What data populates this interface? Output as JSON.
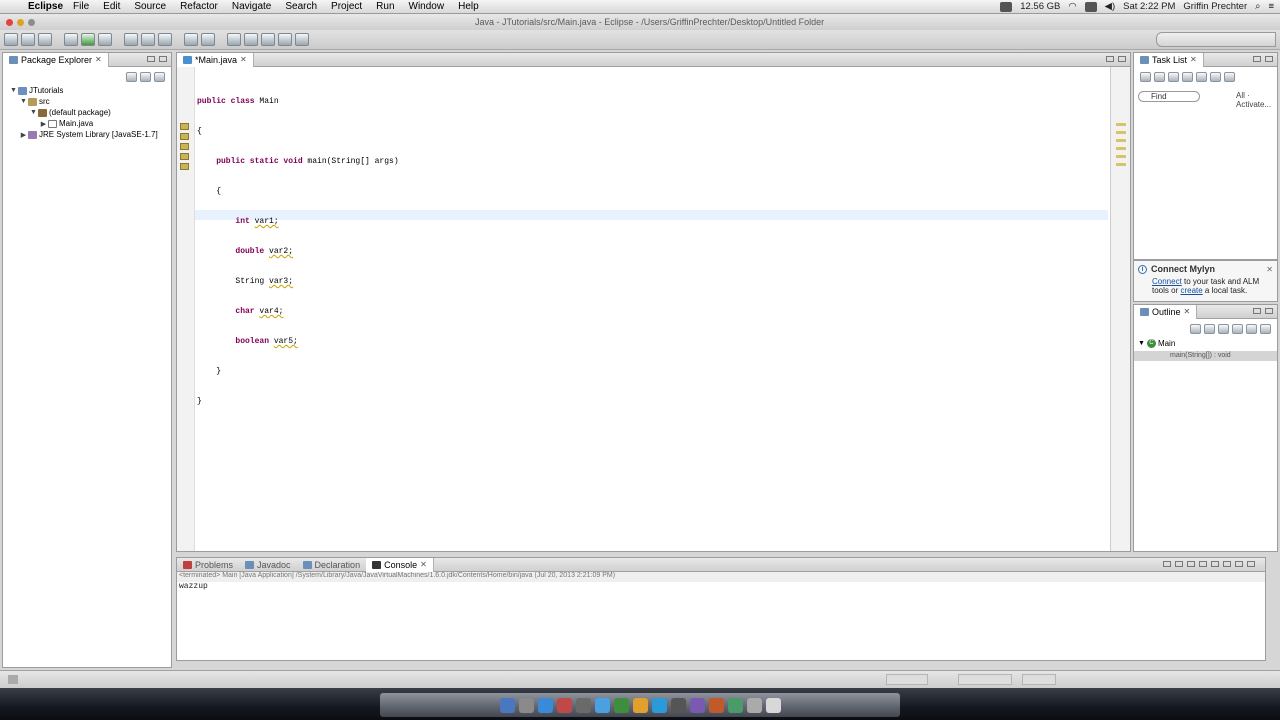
{
  "menubar": {
    "app_name": "Eclipse",
    "items": [
      "File",
      "Edit",
      "Source",
      "Refactor",
      "Navigate",
      "Search",
      "Project",
      "Run",
      "Window",
      "Help"
    ],
    "clock": "Sat 2:22 PM",
    "user": "Griffin Prechter",
    "memory": "12.56 GB"
  },
  "window": {
    "title": "Java - JTutorials/src/Main.java - Eclipse - /Users/GriffinPrechter/Desktop/Untitled Folder"
  },
  "package_explorer": {
    "tab_label": "Package Explorer",
    "tree": [
      {
        "label": "JTutorials",
        "depth": 0,
        "twisty": "▼"
      },
      {
        "label": "src",
        "depth": 1,
        "twisty": "▼"
      },
      {
        "label": "(default package)",
        "depth": 2,
        "twisty": "▼"
      },
      {
        "label": "Main.java",
        "depth": 3,
        "twisty": "▶"
      },
      {
        "label": "JRE System Library [JavaSE-1.7]",
        "depth": 1,
        "twisty": "▶"
      }
    ]
  },
  "editor": {
    "tab_label": "*Main.java",
    "lines": [
      "public class Main",
      "{",
      "    public static void main(String[] args)",
      "    {",
      "        int var1;",
      "        double var2;",
      "        String var3;",
      "        char var4;",
      "        boolean var5;",
      "    }",
      "}"
    ]
  },
  "task_list": {
    "tab_label": "Task List",
    "find_placeholder": "Find",
    "all_label": "All",
    "activate_label": "Activate..."
  },
  "mylyn": {
    "title": "Connect Mylyn",
    "connect_link": "Connect",
    "text_after_connect": " to your task and ALM",
    "tools_text": "tools or ",
    "create_link": "create",
    "text_after_create": " a local task."
  },
  "outline": {
    "tab_label": "Outline",
    "class_name": "Main",
    "method": "main(String[]) : void"
  },
  "bottom_panel": {
    "tabs": [
      "Problems",
      "Javadoc",
      "Declaration"
    ],
    "console_label": "Console",
    "status_line": "<terminated> Main [Java Application] /System/Library/Java/JavaVirtualMachines/1.6.0.jdk/Contents/Home/bin/java (Jul 20, 2013 2:21:09 PM)",
    "output": "wazzup"
  },
  "colors": {
    "keyword": "#7f0055",
    "current_line": "#e8f2fe",
    "link": "#1a4fa0"
  }
}
